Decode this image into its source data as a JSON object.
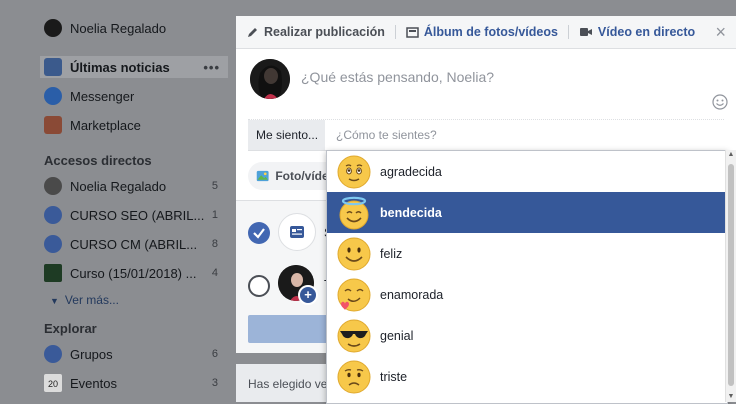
{
  "sidebar": {
    "profile_name": "Noelia Regalado",
    "news_feed": "Últimas noticias",
    "messenger": "Messenger",
    "marketplace": "Marketplace",
    "shortcuts_title": "Accesos directos",
    "shortcuts": [
      {
        "label": "Noelia Regalado",
        "count": "5"
      },
      {
        "label": "CURSO SEO (ABRIL...",
        "count": "1"
      },
      {
        "label": "CURSO CM (ABRIL...",
        "count": "8"
      },
      {
        "label": "Curso (15/01/2018) ...",
        "count": "4"
      }
    ],
    "see_more": "Ver más...",
    "explore_title": "Explorar",
    "explore": [
      {
        "label": "Grupos",
        "count": "6"
      },
      {
        "label": "Eventos",
        "count": "3"
      }
    ],
    "calendar_day": "20"
  },
  "composer": {
    "tabs": {
      "post": "Realizar publicación",
      "album": "Álbum de fotos/vídeos",
      "live": "Vídeo en directo"
    },
    "close": "×",
    "placeholder": "¿Qué estás pensando, Noelia?",
    "feeling_label": "Me siento...",
    "feeling_placeholder": "¿Cómo te sientes?",
    "photo_button": "Foto/vídeo",
    "option_feed_initial": "S",
    "option_story_initial": "T",
    "bottom_text": "Has elegido ver"
  },
  "dropdown": {
    "items": [
      {
        "label": "agradecida",
        "selected": false
      },
      {
        "label": "bendecida",
        "selected": true
      },
      {
        "label": "feliz",
        "selected": false
      },
      {
        "label": "enamorada",
        "selected": false
      },
      {
        "label": "genial",
        "selected": false
      },
      {
        "label": "triste",
        "selected": false
      }
    ]
  },
  "colors": {
    "accent": "#365899",
    "check_blue": "#4267b2",
    "emoji_yellow": "#f7c84a"
  }
}
